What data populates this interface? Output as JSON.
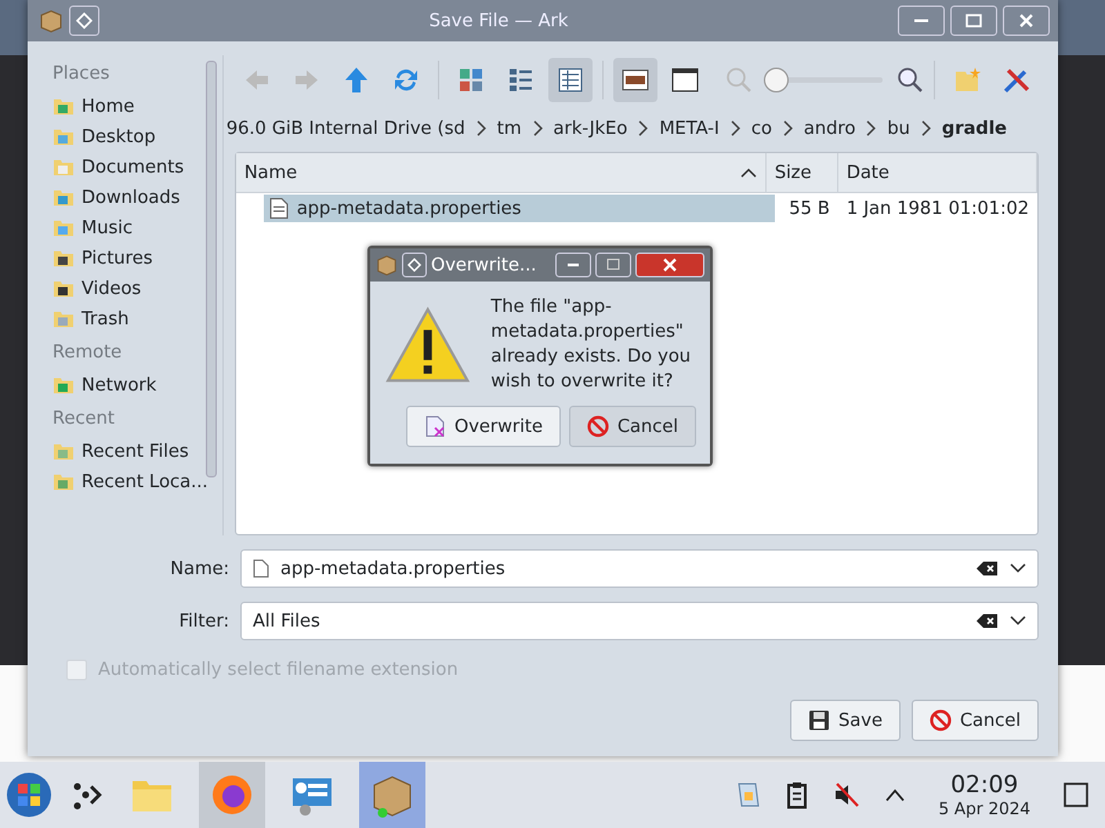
{
  "window": {
    "title": "Save File — Ark"
  },
  "sidebar": {
    "sections": [
      {
        "title": "Places",
        "items": [
          {
            "label": "Home",
            "kind": "home"
          },
          {
            "label": "Desktop",
            "kind": "desktop"
          },
          {
            "label": "Documents",
            "kind": "documents"
          },
          {
            "label": "Downloads",
            "kind": "downloads"
          },
          {
            "label": "Music",
            "kind": "music"
          },
          {
            "label": "Pictures",
            "kind": "pictures"
          },
          {
            "label": "Videos",
            "kind": "videos"
          },
          {
            "label": "Trash",
            "kind": "trash"
          }
        ]
      },
      {
        "title": "Remote",
        "items": [
          {
            "label": "Network",
            "kind": "network"
          }
        ]
      },
      {
        "title": "Recent",
        "items": [
          {
            "label": "Recent Files",
            "kind": "recent-files"
          },
          {
            "label": "Recent Loca...",
            "kind": "recent-locations"
          }
        ]
      }
    ]
  },
  "toolbar": {
    "view_modes": [
      {
        "kind": "icons",
        "selected": false
      },
      {
        "kind": "compact",
        "selected": false
      },
      {
        "kind": "details",
        "selected": true
      }
    ],
    "panels": [
      {
        "kind": "preview",
        "selected": true
      },
      {
        "kind": "panel",
        "selected": false
      }
    ],
    "zoom": {
      "level": 0.05
    }
  },
  "breadcrumb": [
    {
      "label": "96.0 GiB Internal Drive (sd",
      "current": false
    },
    {
      "label": "tm",
      "current": false
    },
    {
      "label": "ark-JkEo",
      "current": false
    },
    {
      "label": "META-I",
      "current": false
    },
    {
      "label": "co",
      "current": false
    },
    {
      "label": "andro",
      "current": false
    },
    {
      "label": "bu",
      "current": false
    },
    {
      "label": "gradle",
      "current": true
    }
  ],
  "file_list": {
    "columns": [
      {
        "label": "Name",
        "sorted": true
      },
      {
        "label": "Size",
        "sorted": false
      },
      {
        "label": "Date",
        "sorted": false
      }
    ],
    "rows": [
      {
        "name": "app-metadata.properties",
        "size": "55 B",
        "date": "1 Jan 1981 01:01:02",
        "selected": true
      }
    ]
  },
  "name_field": {
    "label": "Name:",
    "value": "app-metadata.properties"
  },
  "filter_field": {
    "label": "Filter:",
    "value": "All Files"
  },
  "auto_extension": {
    "label": "Automatically select filename extension",
    "checked": false,
    "disabled": true
  },
  "buttons": [
    {
      "label": "Save",
      "kind": "save"
    },
    {
      "label": "Cancel",
      "kind": "cancel"
    }
  ],
  "overwrite_dialog": {
    "title": "Overwrite...",
    "message": "The file \"app-metadata.properties\" already exists. Do you wish to overwrite it?",
    "buttons": [
      {
        "label": "Overwrite",
        "kind": "overwrite"
      },
      {
        "label": "Cancel",
        "kind": "cancel"
      }
    ]
  },
  "taskbar": {
    "apps": [
      {
        "kind": "files",
        "highlighted": false
      },
      {
        "kind": "firefox",
        "highlighted": true
      },
      {
        "kind": "settings",
        "highlighted": false
      },
      {
        "kind": "ark",
        "highlighted": false,
        "selected": true
      }
    ],
    "clock": {
      "time": "02:09",
      "date": "5 Apr 2024"
    }
  }
}
